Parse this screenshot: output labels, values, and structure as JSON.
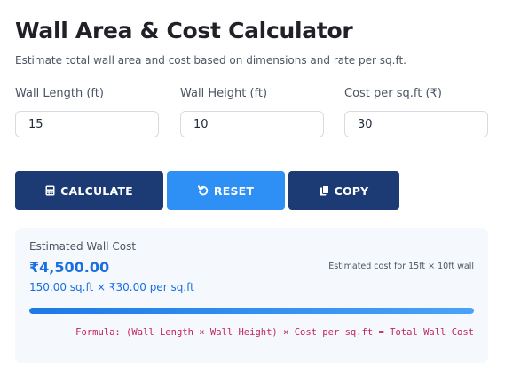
{
  "header": {
    "title": "Wall Area & Cost Calculator",
    "subtitle": "Estimate total wall area and cost based on dimensions and rate per sq.ft."
  },
  "form": {
    "length": {
      "label": "Wall Length (ft)",
      "value": "15"
    },
    "height": {
      "label": "Wall Height (ft)",
      "value": "10"
    },
    "cost": {
      "label": "Cost per sq.ft (₹)",
      "value": "30"
    }
  },
  "buttons": {
    "calculate": {
      "label": "CALCULATE",
      "icon": "calculator-icon",
      "color": "#1c3a74"
    },
    "reset": {
      "label": "RESET",
      "icon": "reset-icon",
      "color": "#2e8ff5"
    },
    "copy": {
      "label": "COPY",
      "icon": "copy-icon",
      "color": "#1c3a74"
    }
  },
  "result": {
    "label": "Estimated Wall Cost",
    "amount": "₹4,500.00",
    "note": "Estimated cost for 15ft × 10ft wall",
    "detail": "150.00 sq.ft × ₹30.00 per sq.ft",
    "progress": 1.0,
    "formula": "Formula: (Wall Length × Wall Height) × Cost per sq.ft = Total Wall Cost"
  },
  "colors": {
    "accent": "#1a6fe0",
    "primary_dark": "#1c3a74",
    "formula": "#c2255c"
  }
}
